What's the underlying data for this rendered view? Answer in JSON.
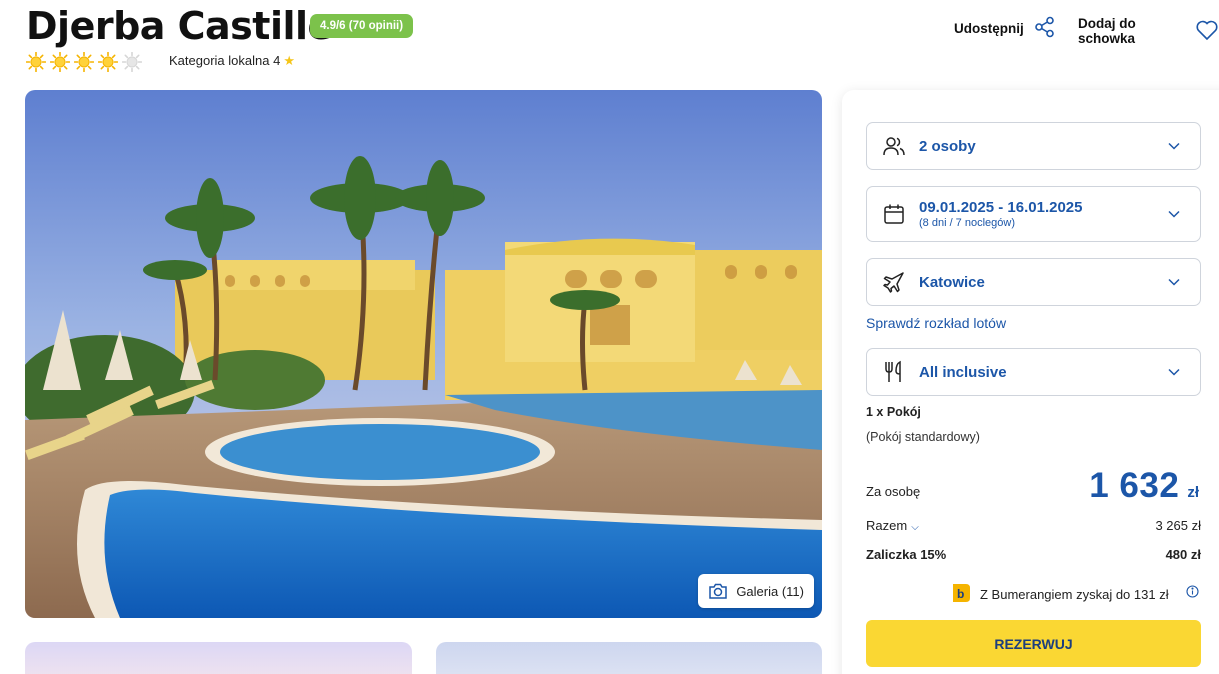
{
  "hotel": {
    "name": "Djerba Castille",
    "rating_badge": "4.9/6 (70 opinii)",
    "sun_rating": 4,
    "sun_max": 5,
    "category_label": "Kategoria lokalna",
    "category_value": "4"
  },
  "actions": {
    "share_label": "Udostępnij",
    "favorite_label": "Dodaj do schowka"
  },
  "gallery": {
    "button_label": "Galeria (11)"
  },
  "booking": {
    "persons": "2 osoby",
    "dates": "09.01.2025 - 16.01.2025",
    "dates_sub": "(8 dni / 7 noclegów)",
    "departure": "Katowice",
    "flight_link": "Sprawdź rozkład lotów",
    "board": "All inclusive",
    "room_count": "1 x Pokój",
    "room_type": "(Pokój standardowy)",
    "per_person_label": "Za osobę",
    "per_person_price": "1 632",
    "currency": "zł",
    "total_label": "Razem",
    "total_value": "3 265 zł",
    "deposit_label": "Zaliczka 15%",
    "deposit_value": "480 zł",
    "bumerang_text": "Z Bumerangiem zyskaj do 131 zł",
    "book_button": "REZERWUJ"
  },
  "colors": {
    "accent_blue": "#1c56a8",
    "badge_green": "#7cc24b",
    "book_yellow": "#fad733",
    "sun_yellow": "#f5c518"
  },
  "icons": {
    "share": "share-icon",
    "favorite": "heart-icon",
    "persons": "people-icon",
    "dates": "calendar-icon",
    "departure": "airplane-icon",
    "board": "cutlery-icon",
    "gallery": "camera-icon",
    "info": "info-icon"
  }
}
